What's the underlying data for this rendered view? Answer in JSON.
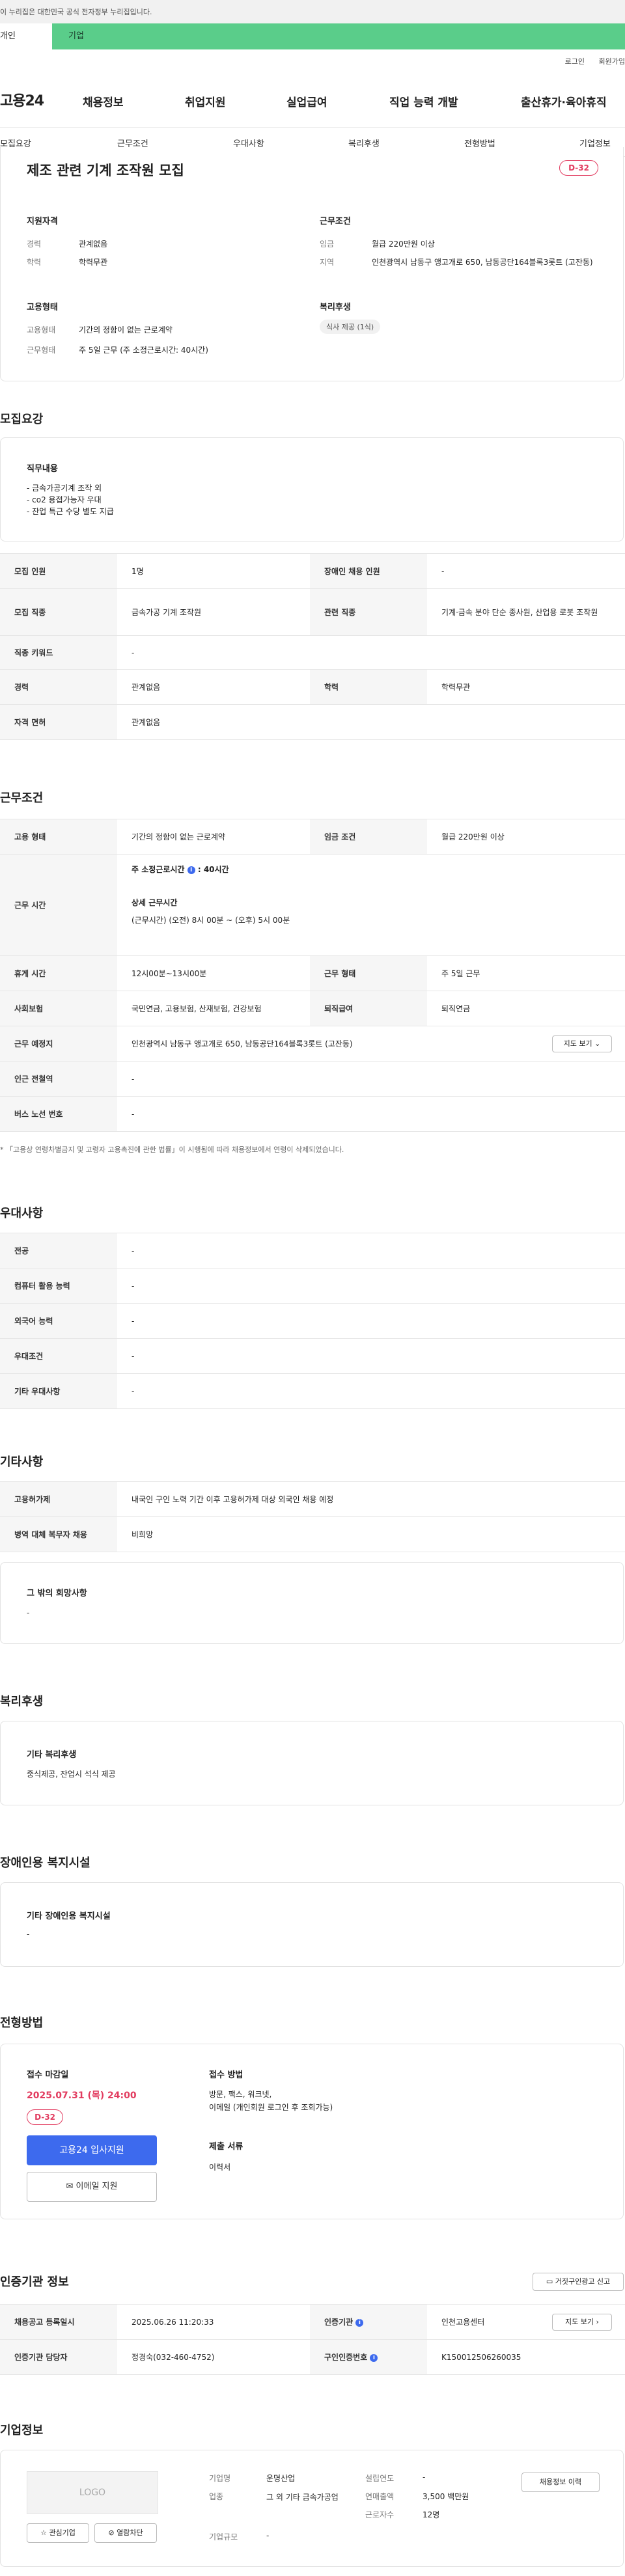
{
  "gov_notice": "이 누리집은 대한민국 공식 전자정부 누리집입니다.",
  "user_tabs": {
    "personal": "개인",
    "company": "기업"
  },
  "top_links": {
    "login": "로그인",
    "signup": "회원가입"
  },
  "logo": "고용24",
  "gnb": [
    "채용정보",
    "취업지원",
    "실업급여",
    "직업 능력 개발",
    "출산휴가·육아휴직"
  ],
  "subnav": [
    "모집요강",
    "근무조건",
    "우대사항",
    "복리후생",
    "전형방법",
    "기업정보"
  ],
  "summary": {
    "title": "제조 관련 기계 조작원 모집",
    "dday": "D-32",
    "qual_title": "지원자격",
    "career_label": "경력",
    "career_value": "관계없음",
    "edu_label": "학력",
    "edu_value": "학력무관",
    "work_title": "근무조건",
    "wage_label": "임금",
    "wage_value": "월급 220만원 이상",
    "area_label": "지역",
    "area_value": "인천광역시 남동구 앵고개로 650, 남동공단164블록3롯트 (고잔동)",
    "emp_title": "고용형태",
    "emp_type_label": "고용형태",
    "emp_type_value": "기간의 정함이 없는 근로계약",
    "emp_time_label": "근무형태",
    "emp_time_value": "주 5일 근무 (주 소정근로시간: 40시간)",
    "welfare_title": "복리후생",
    "welfare_tag": "식사 제공 (1식)"
  },
  "recruit": {
    "section_title": "모집요강",
    "duty_title": "직무내용",
    "duty_lines": [
      "- 금속가공기계 조작 외",
      "- co2 용접가능자 우대",
      "- 잔업 특근 수당 별도 지급"
    ],
    "rows": [
      {
        "k1": "모집 인원",
        "v1": "1명",
        "k2": "장애인 채용 인원",
        "v2": "-"
      },
      {
        "k1": "모집 직종",
        "v1": "금속가공 기계 조작원",
        "k2": "관련 직종",
        "v2": "기계·금속 분야 단순 종사원, 산업용 로봇 조작원"
      },
      {
        "k1": "직종 키워드",
        "v1": "-"
      },
      {
        "k1": "경력",
        "v1": "관계없음",
        "k2": "학력",
        "v2": "학력무관"
      },
      {
        "k1": "자격 면허",
        "v1": "관계없음"
      }
    ]
  },
  "workcond": {
    "section_title": "근무조건",
    "emp_type_k": "고용 형태",
    "emp_type_v": "기간의 정함이 없는 근로계약",
    "wage_k": "임금 조건",
    "wage_v": "월급 220만원 이상",
    "hours_k": "근무 시간",
    "hours_weekly_label": "주 소정근로시간",
    "hours_weekly_value": ": 40시간",
    "hours_detail_title": "상세 근무시간",
    "hours_detail_value": "(근무시간) (오전) 8시 00분 ~ (오후) 5시 00분",
    "rest_k": "휴게 시간",
    "rest_v": "12시00분~13시00분",
    "worktype_k": "근무 형태",
    "worktype_v": "주 5일 근무",
    "insure_k": "사회보험",
    "insure_v": "국민연금, 고용보험, 산재보험, 건강보험",
    "retire_k": "퇴직급여",
    "retire_v": "퇴직연금",
    "place_k": "근무 예정지",
    "place_v": "인천광역시 남동구 앵고개로 650, 남동공단164블록3롯트 (고잔동)",
    "map_btn": "지도 보기",
    "subway_k": "인근 전철역",
    "subway_v": "-",
    "bus_k": "버스 노선 번호",
    "bus_v": "-",
    "notice": "* 「고용상 연령차별금지 및 고령자 고용촉진에 관한 법률」이 시행됨에 따라 채용정보에서 연령이 삭제되었습니다."
  },
  "pref": {
    "section_title": "우대사항",
    "rows": [
      {
        "k": "전공",
        "v": "-"
      },
      {
        "k": "컴퓨터 활용 능력",
        "v": "-"
      },
      {
        "k": "외국어 능력",
        "v": "-"
      },
      {
        "k": "우대조건",
        "v": "-"
      },
      {
        "k": "기타 우대사항",
        "v": "-"
      }
    ]
  },
  "etc": {
    "section_title": "기타사항",
    "rows": [
      {
        "k": "고용허가제",
        "v": "내국인 구인 노력 기간 이후 고용허가제 대상 외국인 채용 예정"
      },
      {
        "k": "병역 대체 복무자 채용",
        "v": "비희망"
      }
    ],
    "other_title": "그 밖의 희망사항",
    "other_value": "-"
  },
  "welfare": {
    "section_title": "복리후생",
    "box_title": "기타 복리후생",
    "box_value": "중식제공, 잔업시 석식 제공"
  },
  "disabled": {
    "section_title": "장애인용 복지시설",
    "box_title": "기타 장애인용 복지시설",
    "box_value": "-"
  },
  "selection": {
    "section_title": "전형방법",
    "deadline_title": "접수 마감일",
    "deadline_value": "2025.07.31 (목) 24:00",
    "dday": "D-32",
    "apply_btn": "고용24 입사지원",
    "email_btn": "이메일 지원",
    "method_title": "접수 방법",
    "method_line1": "방문, 팩스, 워크넷,",
    "method_line2": "이메일 (개인회원 로그인 후 조회가능)",
    "docs_title": "제출 서류",
    "docs_value": "이력서"
  },
  "cert": {
    "section_title": "인증기관 정보",
    "report_btn": "거짓구인광고 신고",
    "reg_k": "채용공고 등록일시",
    "reg_v": "2025.06.26 11:20:33",
    "org_k": "인증기관",
    "org_v": "인천고용센터",
    "map_btn": "지도 보기",
    "staff_k": "인증기관 담당자",
    "staff_v": "정경숙(032-460-4752)",
    "certno_k": "구인인증번호",
    "certno_v": "K150012506260035"
  },
  "company": {
    "section_title": "기업정보",
    "logo_text": "LOGO",
    "fav_btn": "관심기업",
    "block_btn": "열람차단",
    "name_k": "기업명",
    "name_v": "운명산업",
    "industry_k": "업종",
    "industry_v": "그 외 기타 금속가공업",
    "size_k": "기업규모",
    "size_v": "-",
    "founded_k": "설립연도",
    "founded_v": "-",
    "sales_k": "연매출액",
    "sales_v": "3,500 백만원",
    "staff_k": "근로자수",
    "staff_v": "12명",
    "history_btn": "채용정보 이력"
  }
}
